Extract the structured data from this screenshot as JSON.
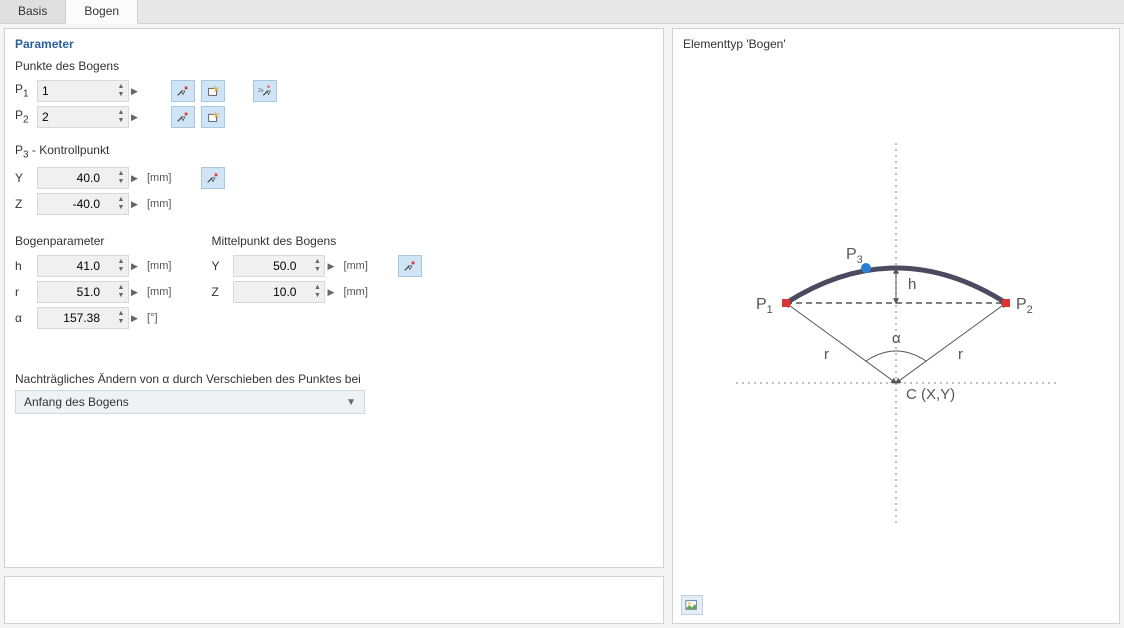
{
  "tabs": {
    "basis": "Basis",
    "bogen": "Bogen",
    "active": "bogen"
  },
  "panel": {
    "title": "Parameter",
    "points_section": "Punkte des Bogens",
    "p1_label": "P",
    "p1_sub": "1",
    "p1_value": "1",
    "p2_label": "P",
    "p2_sub": "2",
    "p2_value": "2",
    "p3_section_a": "P",
    "p3_section_sub": "3",
    "p3_section_b": " - Kontrollpunkt",
    "y_label": "Y",
    "y_value": "40.0",
    "y_unit": "[mm]",
    "z_label": "Z",
    "z_value": "-40.0",
    "z_unit": "[mm]",
    "bogen_section": "Bogenparameter",
    "h_label": "h",
    "h_value": "41.0",
    "h_unit": "[mm]",
    "r_label": "r",
    "r_value": "51.0",
    "r_unit": "[mm]",
    "a_label": "α",
    "a_value": "157.38",
    "a_unit": "[°]",
    "mitte_section": "Mittelpunkt des Bogens",
    "my_label": "Y",
    "my_value": "50.0",
    "my_unit": "[mm]",
    "mz_label": "Z",
    "mz_value": "10.0",
    "mz_unit": "[mm]",
    "shift_label": "Nachträgliches Ändern von α durch Verschieben des Punktes bei",
    "shift_value": "Anfang des Bogens"
  },
  "preview": {
    "title": "Elementtyp 'Bogen'",
    "labels": {
      "p1": "P",
      "p1sub": "1",
      "p2": "P",
      "p2sub": "2",
      "p3": "P",
      "p3sub": "3",
      "h": "h",
      "r": "r",
      "alpha": "α",
      "c": "C (X,Y)"
    }
  }
}
